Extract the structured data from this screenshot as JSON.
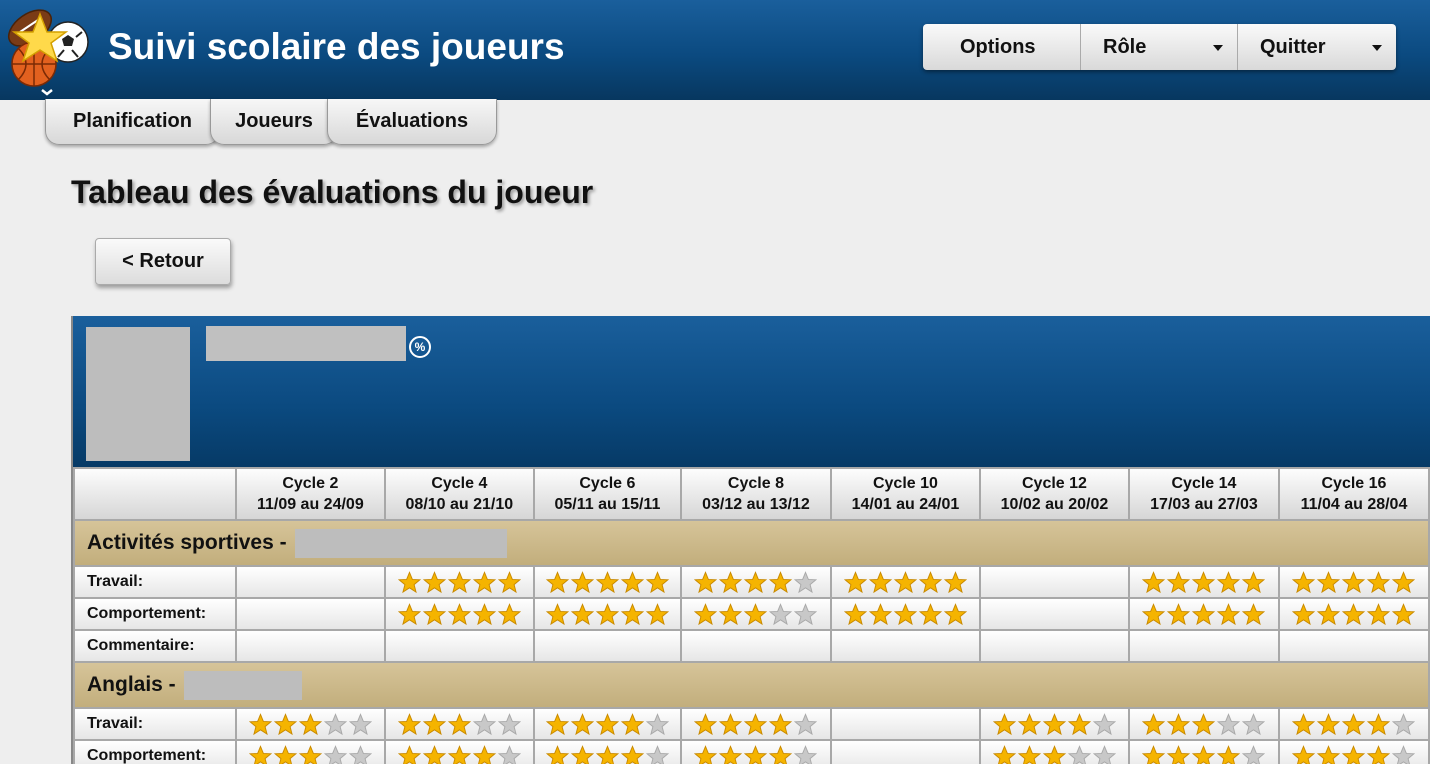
{
  "app": {
    "title": "Suivi scolaire des joueurs"
  },
  "menu": {
    "options": "Options",
    "role": "Rôle",
    "quit": "Quitter"
  },
  "tabs": [
    "Planification",
    "Joueurs",
    "Évaluations"
  ],
  "page": {
    "title": "Tableau des évaluations du joueur",
    "back": "< Retour"
  },
  "panel": {
    "percent_icon": "%"
  },
  "cycles": [
    {
      "name": "Cycle 2",
      "dates": "11/09 au 24/09"
    },
    {
      "name": "Cycle 4",
      "dates": "08/10 au 21/10"
    },
    {
      "name": "Cycle 6",
      "dates": "05/11 au 15/11"
    },
    {
      "name": "Cycle 8",
      "dates": "03/12 au 13/12"
    },
    {
      "name": "Cycle 10",
      "dates": "14/01 au 24/01"
    },
    {
      "name": "Cycle 12",
      "dates": "10/02 au 20/02"
    },
    {
      "name": "Cycle 14",
      "dates": "17/03 au 27/03"
    },
    {
      "name": "Cycle 16",
      "dates": "11/04 au 28/04"
    }
  ],
  "sections": [
    {
      "title": "Activités sportives -",
      "rows": [
        {
          "label": "Travail:",
          "ratings": [
            null,
            5,
            5,
            4,
            5,
            null,
            5,
            5
          ]
        },
        {
          "label": "Comportement:",
          "ratings": [
            null,
            5,
            5,
            3,
            5,
            null,
            5,
            5
          ]
        },
        {
          "label": "Commentaire:",
          "ratings": [
            null,
            null,
            null,
            null,
            null,
            null,
            null,
            null
          ]
        }
      ]
    },
    {
      "title": "Anglais -",
      "rows": [
        {
          "label": "Travail:",
          "ratings": [
            3,
            3,
            4,
            4,
            null,
            4,
            3,
            4
          ]
        },
        {
          "label": "Comportement:",
          "ratings": [
            3,
            4,
            4,
            4,
            null,
            3,
            4,
            4
          ]
        }
      ]
    }
  ],
  "colors": {
    "header": "#0b4a80",
    "section": "#c9b684",
    "star_on": "#f5b400",
    "star_off": "#c8c8c8"
  }
}
